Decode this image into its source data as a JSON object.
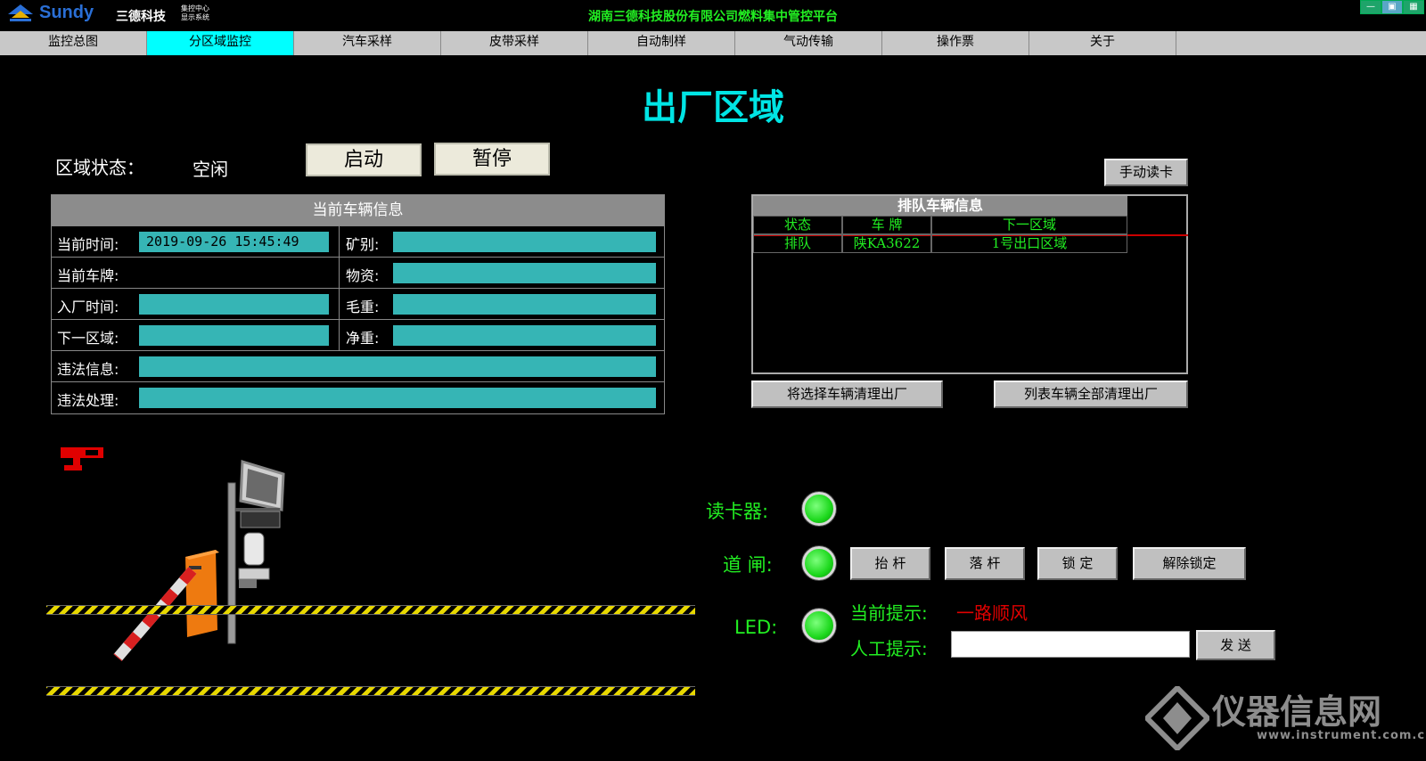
{
  "titlebar": {
    "logo_en": "Sundy",
    "logo_cn": "三德科技",
    "logo_sub1": "集控中心",
    "logo_sub2": "显示系统",
    "platform_title": "湖南三德科技股份有限公司燃料集中管控平台",
    "colors": {
      "logo": "#2a6fd6",
      "title": "#22ee22"
    }
  },
  "nav": {
    "items": [
      "监控总图",
      "分区域监控",
      "汽车采样",
      "皮带采样",
      "自动制样",
      "气动传输",
      "操作票",
      "关于"
    ],
    "active_index": 1,
    "active_color": "#00ffff"
  },
  "area": {
    "title": "出厂区域",
    "status_label": "区域状态：",
    "status_value": "空闲",
    "start_button": "启动",
    "pause_button": "暂停",
    "manual_read_button": "手动读卡"
  },
  "vehicle": {
    "header": "当前车辆信息",
    "current_time_label": "当前时间:",
    "current_time_value": "2019-09-26 15:45:49",
    "mine_label": "矿别:",
    "plate_label": "当前车牌:",
    "material_label": "物资:",
    "entry_time_label": "入厂时间:",
    "gross_label": "毛重:",
    "next_area_label": "下一区域:",
    "net_label": "净重:",
    "violation_info_label": "违法信息:",
    "violation_handle_label": "违法处理:"
  },
  "queue": {
    "header": "排队车辆信息",
    "columns": [
      "状态",
      "车 牌",
      "下一区域"
    ],
    "rows": [
      [
        "排队",
        "陕KA3622",
        "1号出口区域"
      ]
    ],
    "clear_selected_button": "将选择车辆清理出厂",
    "clear_all_button": "列表车辆全部清理出厂"
  },
  "devices": {
    "card_reader_label": "读卡器:",
    "gate_label": "道 闸:",
    "led_label": "LED:",
    "raise_button": "抬 杆",
    "lower_button": "落 杆",
    "lock_button": "锁 定",
    "unlock_button": "解除锁定",
    "current_prompt_label": "当前提示:",
    "current_prompt_value": "一路顺风",
    "manual_prompt_label": "人工提示:",
    "manual_prompt_value": "",
    "send_button": "发 送",
    "indicator_color": "#1cd81c"
  },
  "watermark": {
    "text": "仪器信息网",
    "url": "www.instrument.com.cn"
  }
}
